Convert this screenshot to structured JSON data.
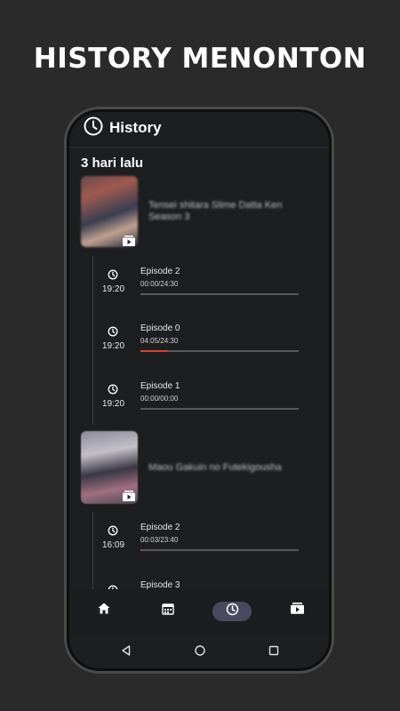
{
  "promo": {
    "title": "HISTORY MENONTON"
  },
  "appbar": {
    "title": "History",
    "icon": "clock-icon"
  },
  "section": {
    "label": "3 hari lalu"
  },
  "anime": [
    {
      "title": "Tensei shitara Slime Datta Ken Season 3",
      "episodes": [
        {
          "title": "Episode 2",
          "time": "19:20",
          "progress": "00:00/24:30",
          "fraction": 0.0
        },
        {
          "title": "Episode 0",
          "time": "19:20",
          "progress": "04:05/24:30",
          "fraction": 0.167
        },
        {
          "title": "Episode 1",
          "time": "19:20",
          "progress": "00:00/00:00",
          "fraction": 0.0
        }
      ]
    },
    {
      "title": "Maou Gakuin no Futekigousha",
      "episodes": [
        {
          "title": "Episode 2",
          "time": "16:09",
          "progress": "00:03/23:40",
          "fraction": 0.002
        },
        {
          "title": "Episode 3"
        }
      ]
    }
  ],
  "bottom_nav": [
    {
      "name": "home",
      "icon": "home-icon"
    },
    {
      "name": "schedule",
      "icon": "calendar-icon"
    },
    {
      "name": "history",
      "icon": "clock-icon",
      "active": true
    },
    {
      "name": "library",
      "icon": "video-library-icon"
    }
  ],
  "system_nav": [
    "back-icon",
    "home-circle-icon",
    "recents-icon"
  ],
  "colors": {
    "background": "#2a2a2a",
    "screen": "#1c1e20",
    "accent": "#d8403a",
    "nav_active": "#4a4a5e"
  }
}
